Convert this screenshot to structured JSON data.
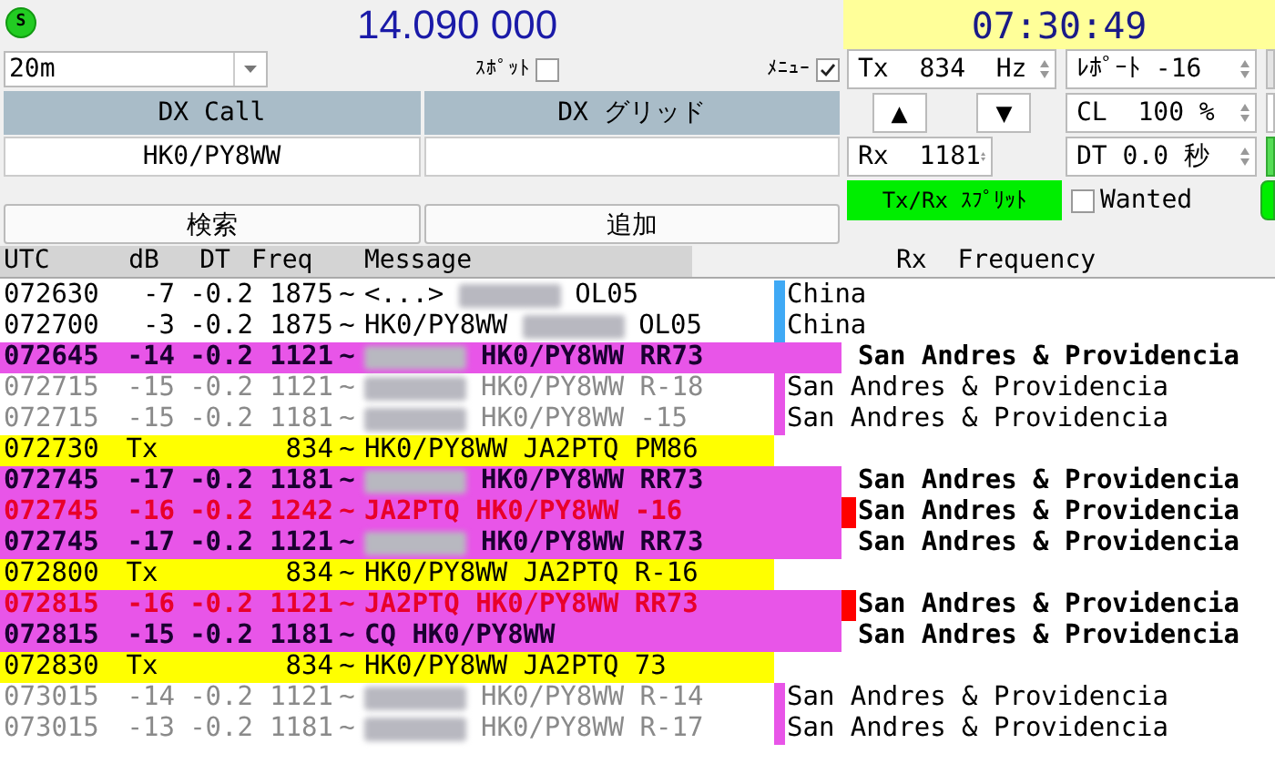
{
  "status": {
    "indicator": "S",
    "frequency": "14.090 000",
    "clock": "07:30:49"
  },
  "left_panel": {
    "band": {
      "value": "20m"
    },
    "spot": {
      "label": "ｽﾎﾟｯﾄ",
      "checked": false
    },
    "menu": {
      "label": "ﾒﾆｭｰ",
      "checked": true
    },
    "dx_call": {
      "label": "DX Call",
      "value": "HK0/PY8WW"
    },
    "dx_grid": {
      "label": "DX グリッド"
    },
    "buttons": [
      "検索",
      "追加"
    ]
  },
  "right_panel": {
    "tx_freq": "Tx  834  Hz",
    "report": "ﾚﾎﾟｰﾄ -16",
    "up": "▲",
    "down": "▼",
    "cl": "CL  100 %",
    "rx_freq": "Rx  1181",
    "dt": "DT 0.0 秒",
    "split": {
      "label": "Tx/Rx ｽﾌﾟﾘｯﾄ",
      "on": true
    },
    "wanted": {
      "label": "Wanted",
      "checked": false
    }
  },
  "table": {
    "columns": [
      "UTC",
      "dB",
      "DT",
      "Freq",
      "Message"
    ],
    "rx_header": "Rx  Frequency",
    "rows": [
      {
        "kind": "normal",
        "utc": "072630",
        "db": "-7",
        "dt": "-0.2",
        "freq": "1875",
        "mode": "~",
        "message": [
          {
            "kind": "text",
            "text": "<...>"
          },
          {
            "kind": "redacted"
          },
          {
            "kind": "text",
            "text": "OL05"
          }
        ],
        "color": "#3fa9f5",
        "country": "China"
      },
      {
        "kind": "normal",
        "utc": "072700",
        "db": "-3",
        "dt": "-0.2",
        "freq": "1875",
        "mode": "~",
        "message": [
          {
            "kind": "text",
            "text": "HK0/PY8WW"
          },
          {
            "kind": "redacted"
          },
          {
            "kind": "text",
            "text": "OL05"
          }
        ],
        "color": "#3fa9f5",
        "country": "China"
      },
      {
        "kind": "highlight",
        "utc": "072645",
        "db": "-14",
        "dt": "-0.2",
        "freq": "1121",
        "mode": "~",
        "message": [
          {
            "kind": "redacted"
          },
          {
            "kind": "text",
            "text": "HK0/PY8WW RR73"
          }
        ],
        "country": "San Andres & Providencia"
      },
      {
        "kind": "faded",
        "utc": "072715",
        "db": "-15",
        "dt": "-0.2",
        "freq": "1121",
        "mode": "~",
        "message": [
          {
            "kind": "redacted"
          },
          {
            "kind": "text",
            "text": "HK0/PY8WW R-18"
          }
        ],
        "color": "#e855e8",
        "country": "San Andres & Providencia"
      },
      {
        "kind": "faded",
        "utc": "072715",
        "db": "-15",
        "dt": "-0.2",
        "freq": "1181",
        "mode": "~",
        "message": [
          {
            "kind": "redacted"
          },
          {
            "kind": "text",
            "text": "HK0/PY8WW -15"
          }
        ],
        "color": "#e855e8",
        "country": "San Andres & Providencia"
      },
      {
        "kind": "tx",
        "utc": "072730",
        "db": "Tx",
        "freq": "834",
        "mode": "~",
        "message": [
          {
            "kind": "text",
            "text": "HK0/PY8WW JA2PTQ PM86"
          }
        ]
      },
      {
        "kind": "highlight",
        "utc": "072745",
        "db": "-17",
        "dt": "-0.2",
        "freq": "1181",
        "mode": "~",
        "message": [
          {
            "kind": "redacted"
          },
          {
            "kind": "text",
            "text": "HK0/PY8WW RR73"
          }
        ],
        "country": "San Andres & Providencia"
      },
      {
        "kind": "mine",
        "utc": "072745",
        "db": "-16",
        "dt": "-0.2",
        "freq": "1242",
        "mode": "~",
        "message": [
          {
            "kind": "text",
            "text": "JA2PTQ HK0/PY8WW -16"
          }
        ],
        "color": "#ff0000",
        "country": "San Andres & Providencia"
      },
      {
        "kind": "highlight",
        "utc": "072745",
        "db": "-17",
        "dt": "-0.2",
        "freq": "1121",
        "mode": "~",
        "message": [
          {
            "kind": "redacted"
          },
          {
            "kind": "text",
            "text": "HK0/PY8WW RR73"
          }
        ],
        "country": "San Andres & Providencia"
      },
      {
        "kind": "tx",
        "utc": "072800",
        "db": "Tx",
        "freq": "834",
        "mode": "~",
        "message": [
          {
            "kind": "text",
            "text": "HK0/PY8WW JA2PTQ R-16"
          }
        ]
      },
      {
        "kind": "mine",
        "utc": "072815",
        "db": "-16",
        "dt": "-0.2",
        "freq": "1121",
        "mode": "~",
        "message": [
          {
            "kind": "text",
            "text": "JA2PTQ HK0/PY8WW RR73"
          }
        ],
        "color": "#ff0000",
        "country": "San Andres & Providencia"
      },
      {
        "kind": "highlight",
        "utc": "072815",
        "db": "-15",
        "dt": "-0.2",
        "freq": "1181",
        "mode": "~",
        "message": [
          {
            "kind": "text",
            "text": "CQ HK0/PY8WW"
          }
        ],
        "country": "San Andres & Providencia"
      },
      {
        "kind": "tx",
        "utc": "072830",
        "db": "Tx",
        "freq": "834",
        "mode": "~",
        "message": [
          {
            "kind": "text",
            "text": "HK0/PY8WW JA2PTQ 73"
          }
        ]
      },
      {
        "kind": "faded",
        "utc": "073015",
        "db": "-14",
        "dt": "-0.2",
        "freq": "1121",
        "mode": "~",
        "message": [
          {
            "kind": "redacted"
          },
          {
            "kind": "text",
            "text": "HK0/PY8WW R-14"
          }
        ],
        "color": "#e855e8",
        "country": "San Andres & Providencia"
      },
      {
        "kind": "faded",
        "utc": "073015",
        "db": "-13",
        "dt": "-0.2",
        "freq": "1181",
        "mode": "~",
        "message": [
          {
            "kind": "redacted"
          },
          {
            "kind": "text",
            "text": "HK0/PY8WW R-17"
          }
        ],
        "color": "#e855e8",
        "country": "San Andres & Providencia"
      }
    ]
  }
}
